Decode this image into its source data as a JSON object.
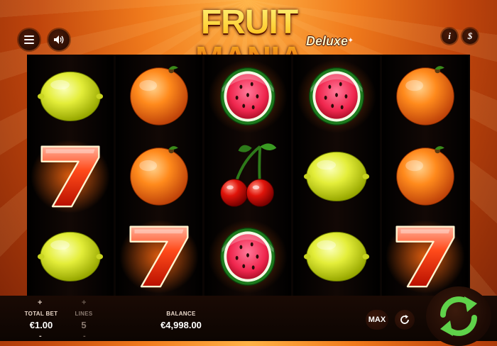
{
  "game": {
    "title": "FRUIT MANIA",
    "subtitle": "Deluxe"
  },
  "top_controls": {
    "menu_icon": "hamburger-menu-icon",
    "sound_icon": "speaker-icon",
    "info_icon": "info-icon",
    "paytable_icon": "dollar-icon",
    "info_label": "i",
    "paytable_label": "$"
  },
  "reels": [
    [
      "lemon",
      "seven",
      "lemon"
    ],
    [
      "orange",
      "orange",
      "seven"
    ],
    [
      "watermelon",
      "cherries",
      "watermelon"
    ],
    [
      "watermelon",
      "lemon",
      "lemon"
    ],
    [
      "orange",
      "orange",
      "seven"
    ]
  ],
  "bottom_bar": {
    "total_bet_label": "TOTAL BET",
    "total_bet_value": "€1.00",
    "lines_label": "LINES",
    "lines_value": "5",
    "balance_label": "BALANCE",
    "balance_value": "€4,998.00",
    "plus": "+",
    "minus": "-",
    "max_label": "MAX",
    "autoplay_icon": "refresh-icon",
    "spin_icon": "spin-arrows-icon"
  },
  "colors": {
    "background_orange": "#f07a1c",
    "panel_dark": "#120602",
    "spin_green": "#5fd24a",
    "logo_gold": "#ffc21a"
  }
}
